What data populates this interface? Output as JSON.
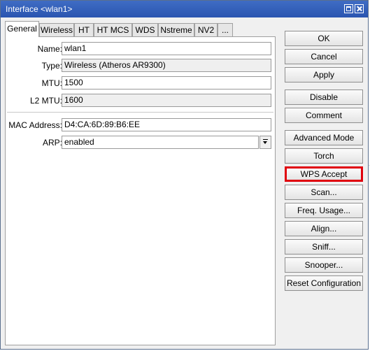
{
  "window": {
    "title": "Interface <wlan1>"
  },
  "tabs": [
    "General",
    "Wireless",
    "HT",
    "HT MCS",
    "WDS",
    "Nstreme",
    "NV2",
    "..."
  ],
  "active_tab": "General",
  "fields": {
    "name": {
      "label": "Name:",
      "value": "wlan1"
    },
    "type": {
      "label": "Type:",
      "value": "Wireless (Atheros AR9300)"
    },
    "mtu": {
      "label": "MTU:",
      "value": "1500"
    },
    "l2mtu": {
      "label": "L2 MTU:",
      "value": "1600"
    },
    "mac": {
      "label": "MAC Address:",
      "value": "D4:CA:6D:89:B6:EE"
    },
    "arp": {
      "label": "ARP:",
      "value": "enabled"
    }
  },
  "buttons": {
    "ok": "OK",
    "cancel": "Cancel",
    "apply": "Apply",
    "disable": "Disable",
    "comment": "Comment",
    "advanced_mode": "Advanced Mode",
    "torch": "Torch",
    "wps_accept": "WPS Accept",
    "scan": "Scan...",
    "freq_usage": "Freq. Usage...",
    "align": "Align...",
    "sniff": "Sniff...",
    "snooper": "Snooper...",
    "reset_configuration": "Reset Configuration"
  },
  "colors": {
    "titlebar": "#2f5ebb",
    "highlight": "#e0000d"
  }
}
